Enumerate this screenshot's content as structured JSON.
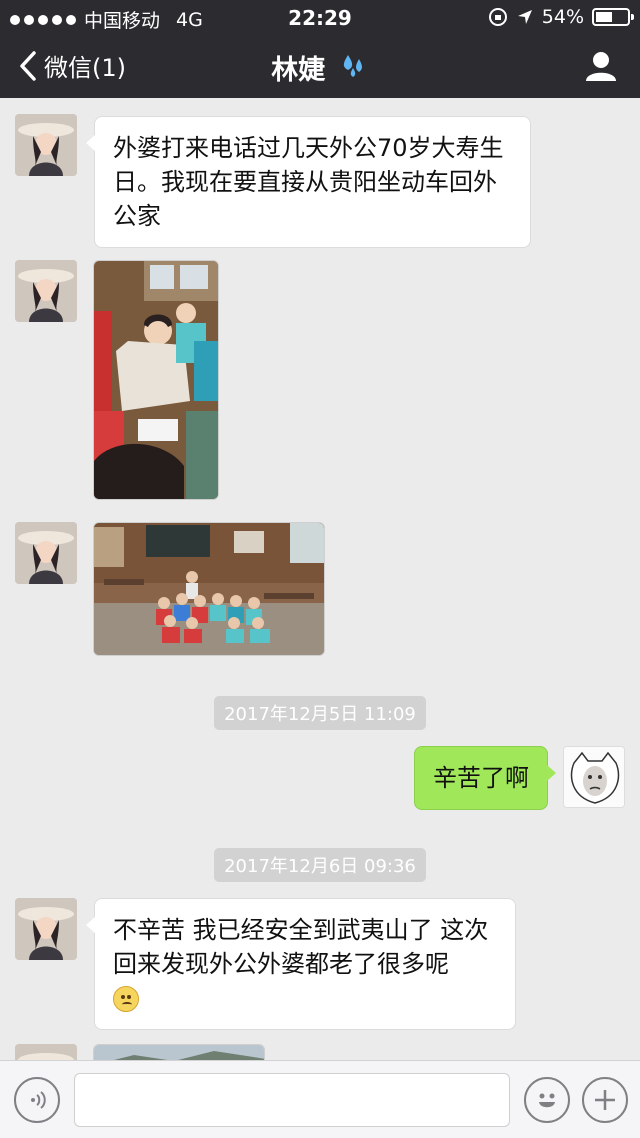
{
  "status_bar": {
    "carrier": "中国移动",
    "network": "4G",
    "time": "22:29",
    "battery_text": "54%",
    "battery_level": 0.54
  },
  "nav": {
    "back_label": "微信(1)",
    "title": "林婕",
    "title_emoji_icon": "water-drops-icon",
    "contact_icon": "person-icon"
  },
  "messages": [
    {
      "sender": "friend",
      "type": "text",
      "text": "外婆打来电话过几天外公70岁大寿生日。我现在要直接从贵阳坐动车回外公家"
    },
    {
      "sender": "friend",
      "type": "image"
    },
    {
      "sender": "friend",
      "type": "image"
    },
    {
      "type": "timestamp",
      "text": "2017年12月5日 11:09"
    },
    {
      "sender": "me",
      "type": "text",
      "text": "辛苦了啊"
    },
    {
      "type": "timestamp",
      "text": "2017年12月6日 09:36"
    },
    {
      "sender": "friend",
      "type": "text",
      "text": "不辛苦  我已经安全到武夷山了  这次回来发现外公外婆都老了很多呢",
      "emoji": "sad-face-icon"
    },
    {
      "sender": "friend",
      "type": "image"
    }
  ],
  "input_bar": {
    "voice_icon": "voice-icon",
    "emoji_icon": "smiley-icon",
    "plus_icon": "plus-icon",
    "placeholder": ""
  },
  "colors": {
    "header_bg": "#2b2b30",
    "chat_bg": "#ebebeb",
    "my_bubble": "#a0e75a",
    "friend_bubble": "#ffffff"
  }
}
